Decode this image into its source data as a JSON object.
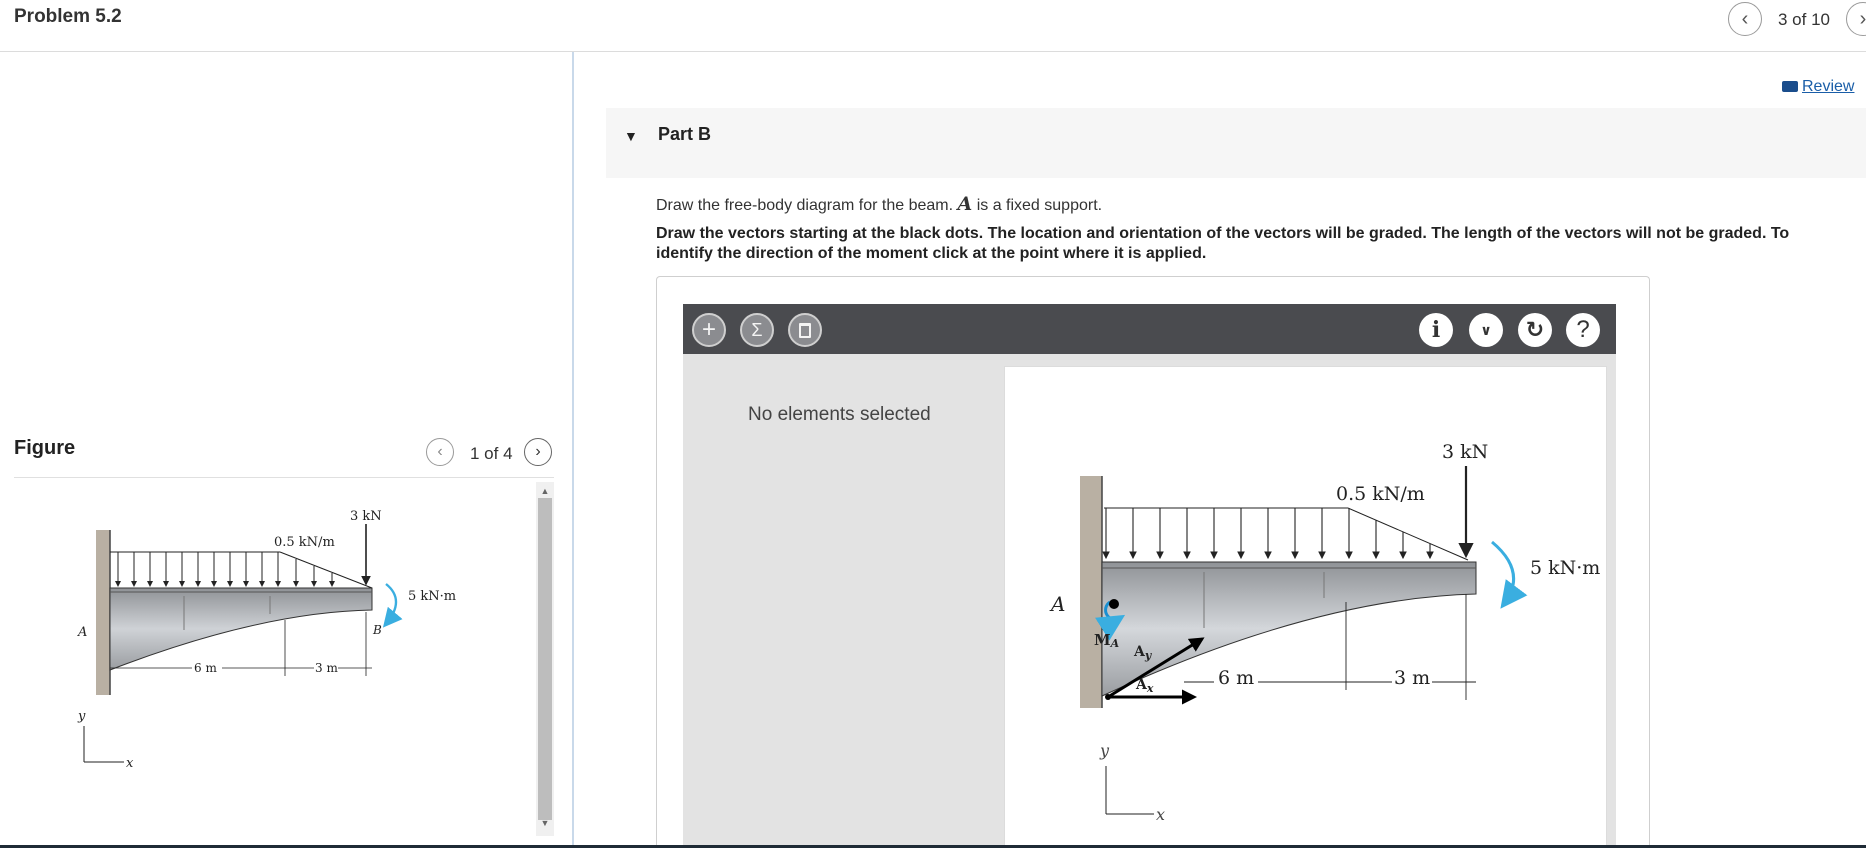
{
  "header": {
    "problem_title": "Problem 5.2",
    "position": "3 of 10",
    "prev_icon": "chevron-left-icon",
    "next_icon": "chevron-right-icon"
  },
  "figure_panel": {
    "label": "Figure",
    "position": "1 of 4",
    "labels": {
      "force": "3 kN",
      "distributed": "0.5 kN/m",
      "moment": "5 kN·m",
      "dim_left": "6 m",
      "dim_right": "3 m",
      "point_a": "A",
      "point_b": "B",
      "axis_y": "y",
      "axis_x": "x"
    }
  },
  "review": {
    "label": "Review",
    "icon": "book-icon"
  },
  "part": {
    "title": "Part B",
    "caret_icon": "caret-down-icon",
    "instruction_prefix": "Draw the free-body diagram for the beam.",
    "instruction_var": "A",
    "instruction_suffix": "is a fixed support.",
    "instruction_bold": "Draw the vectors starting at the black dots. The location and orientation of the vectors will be graded. The length of the vectors will not be graded. To identify the direction of the moment click at the point where it is applied."
  },
  "tool": {
    "buttons_left": [
      "plus-icon",
      "sigma-icon",
      "trash-icon"
    ],
    "buttons_right": [
      "info-icon",
      "chevron-down-icon",
      "reset-icon",
      "help-icon"
    ],
    "side_text": "No elements selected",
    "canvas_labels": {
      "force": "3 kN",
      "distributed": "0.5 kN/m",
      "moment": "5 kN·m",
      "dim_left": "6 m",
      "dim_right": "3 m",
      "point_a": "A",
      "moment_a": "M",
      "moment_a_sub": "A",
      "ay": "A",
      "ay_sub": "y",
      "ax": "A",
      "ax_sub": "x",
      "axis_y": "y",
      "axis_x": "x"
    }
  }
}
